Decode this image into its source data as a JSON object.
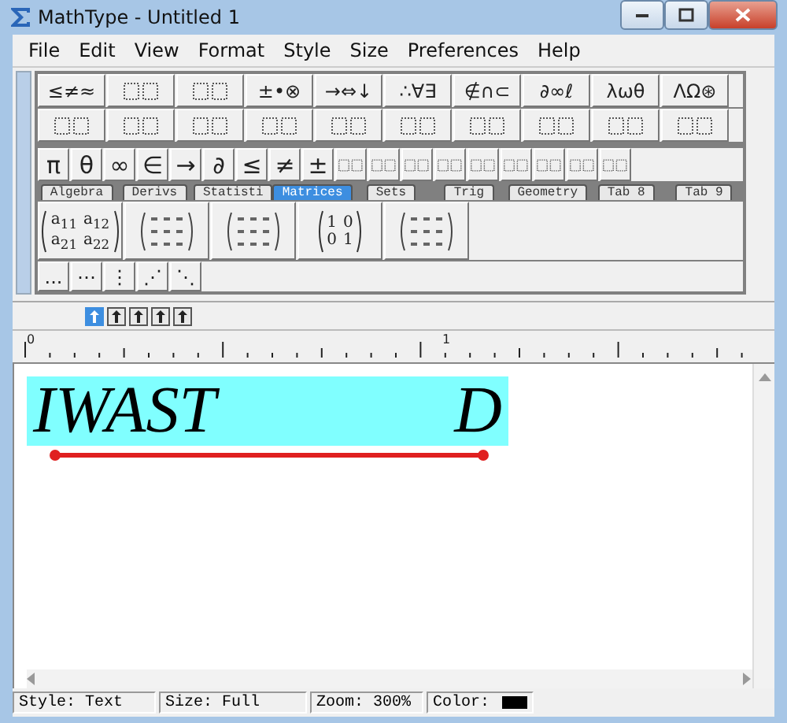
{
  "window": {
    "title": "MathType - Untitled 1"
  },
  "menu": [
    {
      "label": "File"
    },
    {
      "label": "Edit"
    },
    {
      "label": "View"
    },
    {
      "label": "Format"
    },
    {
      "label": "Style"
    },
    {
      "label": "Size"
    },
    {
      "label": "Preferences"
    },
    {
      "label": "Help"
    }
  ],
  "palette_row_1": [
    {
      "kind": "text",
      "label": "≤≠≈"
    },
    {
      "kind": "icon"
    },
    {
      "kind": "icon"
    },
    {
      "kind": "text",
      "label": "±•⊗"
    },
    {
      "kind": "text",
      "label": "→⇔↓"
    },
    {
      "kind": "text",
      "label": "∴∀∃"
    },
    {
      "kind": "text",
      "label": "∉∩⊂"
    },
    {
      "kind": "text",
      "label": "∂∞ℓ"
    },
    {
      "kind": "text",
      "label": "λωθ"
    },
    {
      "kind": "text",
      "label": "ΛΩ⊛"
    }
  ],
  "palette_row_2": [
    {
      "kind": "icon"
    },
    {
      "kind": "icon"
    },
    {
      "kind": "icon"
    },
    {
      "kind": "icon"
    },
    {
      "kind": "icon"
    },
    {
      "kind": "icon"
    },
    {
      "kind": "icon"
    },
    {
      "kind": "icon"
    },
    {
      "kind": "icon"
    },
    {
      "kind": "icon"
    }
  ],
  "symbol_bar": [
    {
      "kind": "text",
      "label": "π"
    },
    {
      "kind": "text",
      "label": "θ"
    },
    {
      "kind": "text",
      "label": "∞"
    },
    {
      "kind": "text",
      "label": "∈"
    },
    {
      "kind": "text",
      "label": "→"
    },
    {
      "kind": "text",
      "label": "∂"
    },
    {
      "kind": "text",
      "label": "≤"
    },
    {
      "kind": "text",
      "label": "≠"
    },
    {
      "kind": "text",
      "label": "±"
    },
    {
      "kind": "icon"
    },
    {
      "kind": "icon"
    },
    {
      "kind": "icon"
    },
    {
      "kind": "icon"
    },
    {
      "kind": "icon"
    },
    {
      "kind": "icon"
    },
    {
      "kind": "icon"
    },
    {
      "kind": "icon"
    },
    {
      "kind": "icon"
    }
  ],
  "tabs": [
    {
      "label": "Algebra",
      "selected": false
    },
    {
      "label": "Derivs",
      "selected": false
    },
    {
      "label": "Statisti",
      "selected": false
    },
    {
      "label": "Matrices",
      "selected": true
    },
    {
      "label": "Sets",
      "selected": false
    },
    {
      "label": "Trig",
      "selected": false
    },
    {
      "label": "Geometry",
      "selected": false
    },
    {
      "label": "Tab 8",
      "selected": false
    },
    {
      "label": "Tab 9",
      "selected": false
    }
  ],
  "matrix_templates": [
    {
      "kind": "cells",
      "cells": [
        "a$_{11}$",
        "a$_{12}$",
        "a$_{21}$",
        "a$_{22}$"
      ]
    },
    {
      "kind": "icon"
    },
    {
      "kind": "icon"
    },
    {
      "kind": "cells",
      "cells": [
        "1",
        "0",
        "0",
        "1"
      ]
    },
    {
      "kind": "icon"
    }
  ],
  "dots_bar": [
    {
      "label": "..."
    },
    {
      "label": "⋯"
    },
    {
      "label": "⋮"
    },
    {
      "label": "⋰"
    },
    {
      "label": "⋱"
    }
  ],
  "nudge_buttons": [
    {
      "selected": true
    },
    {
      "selected": false
    },
    {
      "selected": false
    },
    {
      "selected": false
    },
    {
      "selected": false
    }
  ],
  "ruler": {
    "labels": [
      "0",
      "1"
    ]
  },
  "equation": {
    "text": "IWAST",
    "tail": "D"
  },
  "status_bar": {
    "style": "Style: Text",
    "size": "Size: Full",
    "zoom": "Zoom: 300%",
    "color_label": "Color:",
    "color": "#000000"
  }
}
